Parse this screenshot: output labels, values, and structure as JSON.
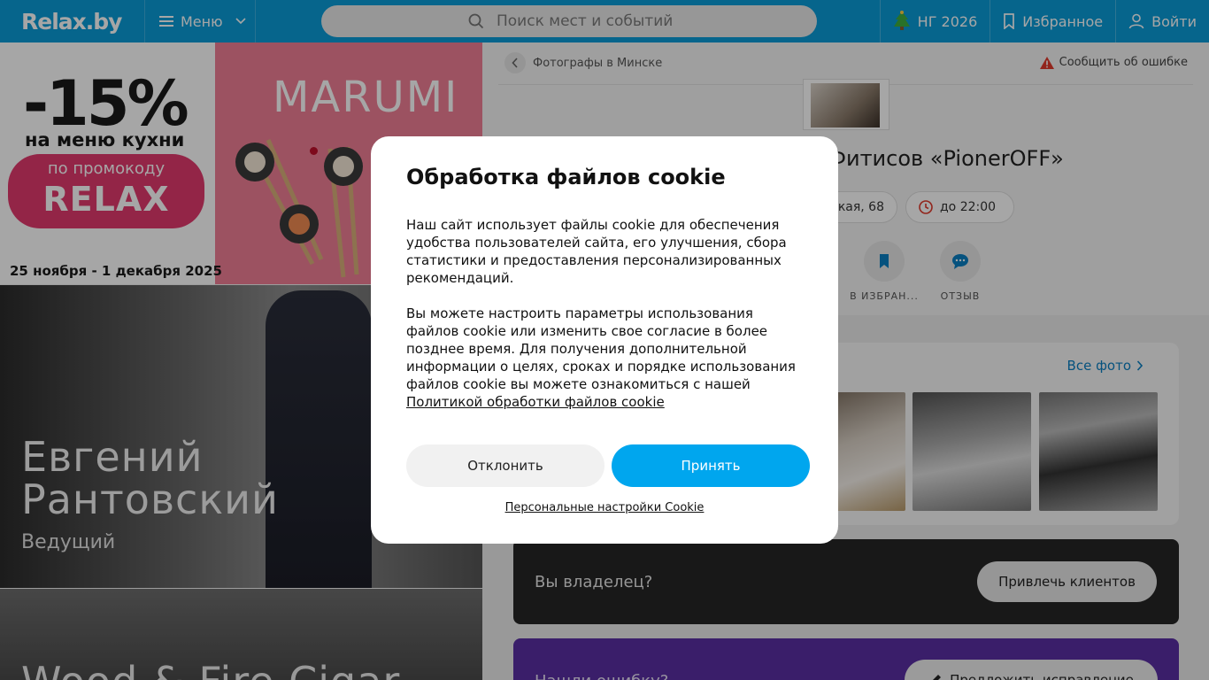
{
  "header": {
    "logo": "Relax.by",
    "menu_label": "Меню",
    "search_placeholder": "Поиск мест и событий",
    "ng_label": "НГ 2026",
    "favorites_label": "Избранное",
    "login_label": "Войти"
  },
  "ads": {
    "promo_discount": "-15%",
    "promo_menu": "на меню кухни",
    "promo_code_label": "по промокоду",
    "promo_code": "RELAX",
    "promo_dates": "25 ноября - 1 декабря 2025",
    "brand": "MARUMI",
    "host_name_line1": "Евгений",
    "host_name_line2": "Рантовский",
    "host_role": "Ведущий",
    "bottom_title": "Wood & Fire Cigar"
  },
  "page": {
    "breadcrumb": "Фотографы в Минске",
    "report_error": "Сообщить об ошибке",
    "title": "о Фитисов «PionerOFF»",
    "address": "кая, 68",
    "hours": "до 22:00",
    "actions": [
      {
        "label": "В ИЗБРАН..."
      },
      {
        "label": "ОТЗЫВ"
      }
    ],
    "all_photos": "Все фото",
    "owner_label": "Вы владелец?",
    "owner_button": "Привлечь клиентов",
    "errors_label": "Нашли ошибку?",
    "errors_button": "Предложить исправление"
  },
  "cookie": {
    "title": "Обработка файлов cookie",
    "paragraph1": "Наш сайт использует файлы cookie для обеспечения удобства пользователей сайта, его улучшения, сбора статистики и предоставления персонализированных рекомендаций.",
    "paragraph2": "Вы можете настроить параметры использования файлов cookie или изменить свое согласие в более позднее время. Для получения дополнительной информации о целях, сроках и порядке использования файлов cookie вы можете ознакомиться с нашей",
    "policy_link": "Политикой обработки файлов cookie",
    "decline": "Отклонить",
    "accept": "Принять",
    "personal_settings": "Персональные настройки Cookie"
  },
  "colors": {
    "header_bg": "#0a9bd7",
    "accept_bg": "#00a6ee",
    "errors_bg": "#5a2fa3",
    "owner_bg": "#252525"
  }
}
